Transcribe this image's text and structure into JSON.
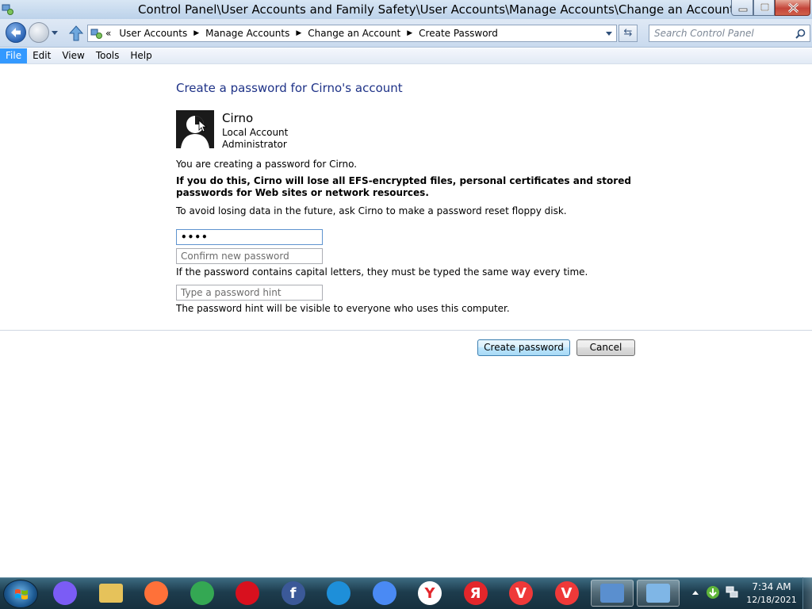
{
  "window": {
    "title": "Control Panel\\User Accounts and Family Safety\\User Accounts\\Manage Accounts\\Change an Account\\C"
  },
  "address_bar": {
    "overflow_glyph": "«",
    "breadcrumbs": [
      "User Accounts",
      "Manage Accounts",
      "Change an Account",
      "Create Password"
    ]
  },
  "search": {
    "placeholder": "Search Control Panel"
  },
  "menu": [
    "File",
    "Edit",
    "View",
    "Tools",
    "Help"
  ],
  "page": {
    "heading": "Create a password for Cirno's account",
    "account": {
      "name": "Cirno",
      "type": "Local Account",
      "role": "Administrator"
    },
    "info_creating": "You are creating a password for Cirno.",
    "warning": "If you do this, Cirno will lose all EFS-encrypted files, personal certificates and stored passwords for Web sites or network resources.",
    "info_reset": "To avoid losing data in the future, ask Cirno to make a password reset floppy disk.",
    "new_password_value": "••••",
    "confirm_placeholder": "Confirm new password",
    "caps_note": "If the password contains capital letters, they must be typed the same way every time.",
    "hint_placeholder": "Type a password hint",
    "hint_note": "The password hint will be visible to everyone who uses this computer.",
    "create_button": "Create password",
    "cancel_button": "Cancel"
  },
  "taskbar": {
    "items": [
      {
        "name": "alice-icon",
        "glyph": "",
        "color": "#7b5cf5"
      },
      {
        "name": "folder-icon",
        "glyph": "",
        "color": "#e6c25a"
      },
      {
        "name": "firefox-icon",
        "glyph": "",
        "color": "#ff7139"
      },
      {
        "name": "chrome-icon",
        "glyph": "",
        "color": "#34a853"
      },
      {
        "name": "opera-icon",
        "glyph": "",
        "color": "#d8101e"
      },
      {
        "name": "facebook-icon",
        "glyph": "f",
        "color": "#3b5998"
      },
      {
        "name": "edge-icon",
        "glyph": "",
        "color": "#1e8fd9"
      },
      {
        "name": "chromium-icon",
        "glyph": "",
        "color": "#4a8af4"
      },
      {
        "name": "yandex-icon",
        "glyph": "Y",
        "color": "#ffffff"
      },
      {
        "name": "yandex-browser-icon",
        "glyph": "Я",
        "color": "#e3262b"
      },
      {
        "name": "vivaldi-icon",
        "glyph": "V",
        "color": "#ef3939"
      },
      {
        "name": "vivaldi-2-icon",
        "glyph": "V",
        "color": "#ef3939"
      },
      {
        "name": "remote-desktop-icon",
        "glyph": "",
        "color": "#5a8fcf"
      },
      {
        "name": "control-panel-icon",
        "glyph": "",
        "color": "#7fb6e6"
      }
    ],
    "clock_time": "7:34 AM",
    "clock_date": "12/18/2021"
  }
}
